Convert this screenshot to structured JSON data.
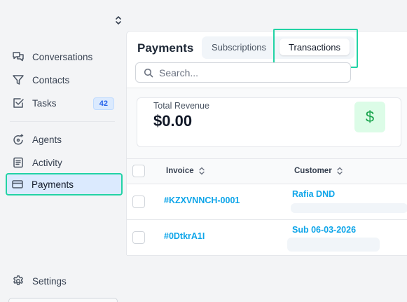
{
  "sidebar": {
    "items": [
      {
        "label": "Conversations",
        "icon": "chat-icon"
      },
      {
        "label": "Contacts",
        "icon": "filter-icon"
      },
      {
        "label": "Tasks",
        "icon": "checkbox-icon",
        "badge": "42"
      },
      {
        "label": "Agents",
        "icon": "agent-icon"
      },
      {
        "label": "Activity",
        "icon": "list-icon"
      },
      {
        "label": "Payments",
        "icon": "card-icon",
        "active": true
      }
    ],
    "settings_label": "Settings"
  },
  "main": {
    "title": "Payments",
    "tabs": [
      {
        "label": "Subscriptions"
      },
      {
        "label": "Transactions",
        "selected": true
      }
    ],
    "search": {
      "placeholder": "Search..."
    },
    "revenue_card": {
      "label": "Total Revenue",
      "value": "$0.00",
      "icon_glyph": "$"
    },
    "table": {
      "headers": {
        "invoice": "Invoice",
        "customer": "Customer"
      },
      "rows": [
        {
          "invoice": "#KZXVNNCH-0001",
          "customer": "Rafia DND"
        },
        {
          "invoice": "#0DtkrA1I",
          "customer": "Sub 06-03-2026"
        }
      ]
    }
  },
  "colors": {
    "accent": "#0ea5e9",
    "highlight_outline": "#22d3a5",
    "active_bg": "#dbeafe",
    "revenue_icon": "#16a34a"
  }
}
